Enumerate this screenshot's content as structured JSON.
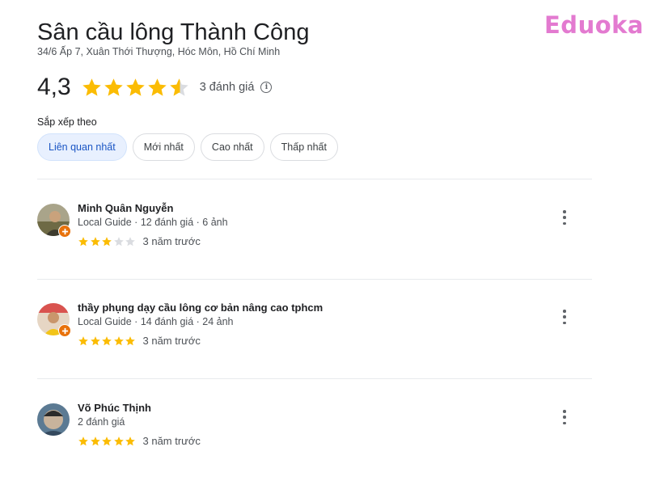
{
  "brand": {
    "logo": "Eduoka",
    "color": "#e37ad0"
  },
  "place": {
    "title": "Sân cầu lông Thành Công",
    "address": "34/6 Ấp 7, Xuân Thới Thượng, Hóc Môn, Hồ Chí Minh",
    "rating": "4,3",
    "rating_value": 4.3,
    "review_count": "3 đánh giá",
    "info_icon": "i"
  },
  "sort": {
    "label": "Sắp xếp theo",
    "options": [
      "Liên quan nhất",
      "Mới nhất",
      "Cao nhất",
      "Thấp nhất"
    ],
    "selected": "Liên quan nhất"
  },
  "colors": {
    "star": "#fbbc04",
    "star_empty": "#dadce0",
    "chip_active": "#e8f0fe",
    "local_guide_badge": "#e8710a"
  },
  "reviews": [
    {
      "name": "Minh Quân Nguyễn",
      "meta": "Local Guide · 12 đánh giá · 6 ảnh",
      "stars": 3,
      "time": "3 năm trước",
      "local_guide": true
    },
    {
      "name": "thầy phụng dạy cầu lông cơ bản nâng cao tphcm",
      "meta": "Local Guide · 14 đánh giá · 24 ảnh",
      "stars": 5,
      "time": "3 năm trước",
      "local_guide": true
    },
    {
      "name": "Võ Phúc Thịnh",
      "meta": "2 đánh giá",
      "stars": 5,
      "time": "3 năm trước",
      "local_guide": false
    }
  ]
}
